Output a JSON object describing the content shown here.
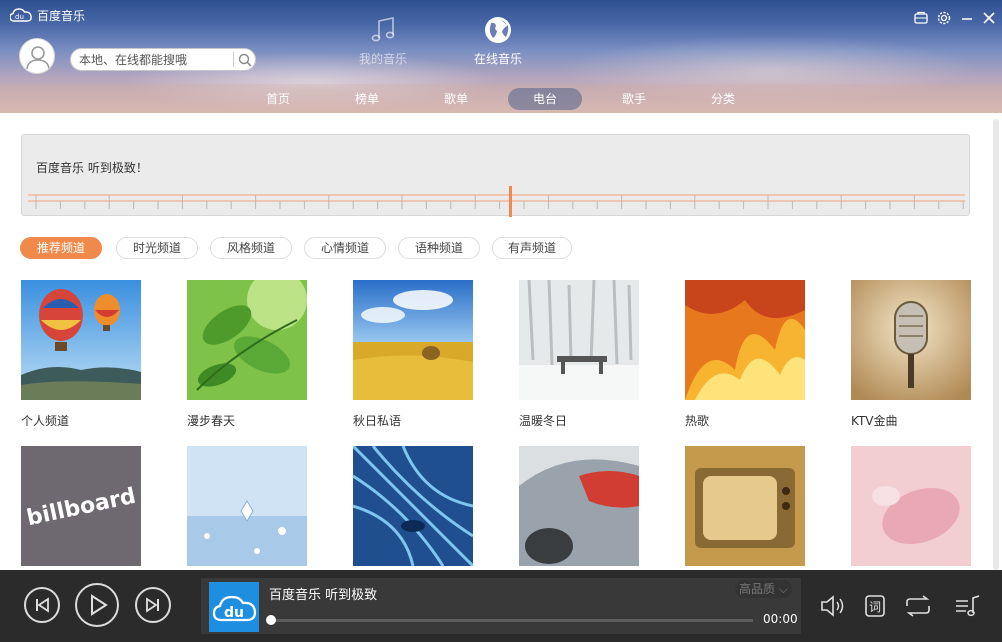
{
  "app": {
    "title": "百度音乐"
  },
  "search": {
    "placeholder": "本地、在线都能搜哦"
  },
  "topnav": [
    {
      "label": "我的音乐",
      "icon": "music-note-icon",
      "active": false
    },
    {
      "label": "在线音乐",
      "icon": "globe-icon",
      "active": true
    }
  ],
  "tabs": [
    {
      "label": "首页",
      "selected": false
    },
    {
      "label": "榜单",
      "selected": false
    },
    {
      "label": "歌单",
      "selected": false
    },
    {
      "label": "电台",
      "selected": true
    },
    {
      "label": "歌手",
      "selected": false
    },
    {
      "label": "分类",
      "selected": false
    }
  ],
  "dial": {
    "text": "百度音乐 听到极致！"
  },
  "channel_tabs": [
    {
      "label": "推荐频道",
      "active": true
    },
    {
      "label": "时光频道",
      "active": false
    },
    {
      "label": "风格频道",
      "active": false
    },
    {
      "label": "心情频道",
      "active": false
    },
    {
      "label": "语种频道",
      "active": false
    },
    {
      "label": "有声频道",
      "active": false
    }
  ],
  "channels": [
    {
      "name": "个人频道",
      "theme": "hot-air-balloons"
    },
    {
      "name": "漫步春天",
      "theme": "green-leaves"
    },
    {
      "name": "秋日私语",
      "theme": "autumn-field"
    },
    {
      "name": "温暖冬日",
      "theme": "snowy-bench"
    },
    {
      "name": "热歌",
      "theme": "fire"
    },
    {
      "name": "KTV金曲",
      "theme": "microphone"
    },
    {
      "name": "",
      "theme": "billboard",
      "logo_text": "billboard"
    },
    {
      "name": "",
      "theme": "ice-crystal"
    },
    {
      "name": "",
      "theme": "blue-tunnel"
    },
    {
      "name": "",
      "theme": "car"
    },
    {
      "name": "",
      "theme": "retro-tv"
    },
    {
      "name": "",
      "theme": "pink-phone"
    }
  ],
  "player": {
    "track_title": "百度音乐 听到极致",
    "quality_label": "高品质",
    "time": "00:00",
    "progress": 0,
    "buttons": [
      "prev-icon",
      "play-icon",
      "next-icon",
      "volume-icon",
      "lyrics-icon",
      "repeat-icon",
      "playlist-icon"
    ],
    "lyrics_label": "词"
  },
  "colors": {
    "accent": "#f08a4b",
    "player_bg": "#2b2b2b",
    "album_blue": "#1e8fe0"
  }
}
